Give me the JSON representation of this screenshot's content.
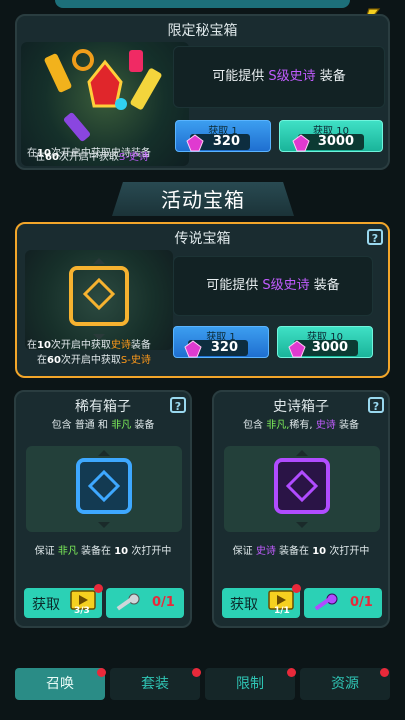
{
  "limited_chest": {
    "title": "限定秘宝箱",
    "desc_prefix": "可能提供",
    "desc_highlight": "S级史诗",
    "desc_suffix": "装备",
    "note_line1_a": "在",
    "note_line1_num": "10",
    "note_line1_b": "次开启中获取史诗装备",
    "note_line2_a": "在",
    "note_line2_num": "60",
    "note_line2_b": "次开启中获取",
    "note_line2_highlight": "S-史诗",
    "buy1_label": "获取 1",
    "buy1_price": "320",
    "buy10_label": "获取 10",
    "buy10_price": "3000"
  },
  "section_title": "活动宝箱",
  "legendary_chest": {
    "title": "传说宝箱",
    "help": "?",
    "desc_prefix": "可能提供",
    "desc_highlight": "S级史诗",
    "desc_suffix": "装备",
    "note_line1_a": "在",
    "note_line1_num": "10",
    "note_line1_b": "次开启中获取",
    "note_line1_highlight": "史诗",
    "note_line1_c": "装备",
    "note_line2_a": "在",
    "note_line2_num": "60",
    "note_line2_b": "次开启中获取",
    "note_line2_highlight": "S-史诗",
    "buy1_label": "获取 1",
    "buy1_price": "320",
    "buy10_label": "获取 10",
    "buy10_price": "3000"
  },
  "rare_box": {
    "title": "稀有箱子",
    "help": "?",
    "contains_a": "包含",
    "contains_b": "普通",
    "contains_c": "和",
    "contains_d": "非凡",
    "contains_e": "装备",
    "guarantee_a": "保证",
    "guarantee_b": "非凡",
    "guarantee_c": "装备在",
    "guarantee_num": "10",
    "guarantee_d": "次打开中",
    "get_label": "获取",
    "ad_count": "3/3",
    "key_count": "0/1"
  },
  "epic_box": {
    "title": "史诗箱子",
    "help": "?",
    "contains_a": "包含",
    "contains_b": "非凡,",
    "contains_c": "稀有,",
    "contains_d": "史诗",
    "contains_e": "装备",
    "guarantee_a": "保证",
    "guarantee_b": "史诗",
    "guarantee_c": "装备在",
    "guarantee_num": "10",
    "guarantee_d": "次打开中",
    "get_label": "获取",
    "ad_count": "1/1",
    "key_count": "0/1"
  },
  "tabs": [
    {
      "label": "召唤"
    },
    {
      "label": "套装"
    },
    {
      "label": "限制"
    },
    {
      "label": "资源"
    }
  ],
  "colors": {
    "accent_orange": "#f3a62a",
    "teal": "#1fc4a8",
    "blue": "#2a86e0",
    "purple": "#b04cff"
  }
}
